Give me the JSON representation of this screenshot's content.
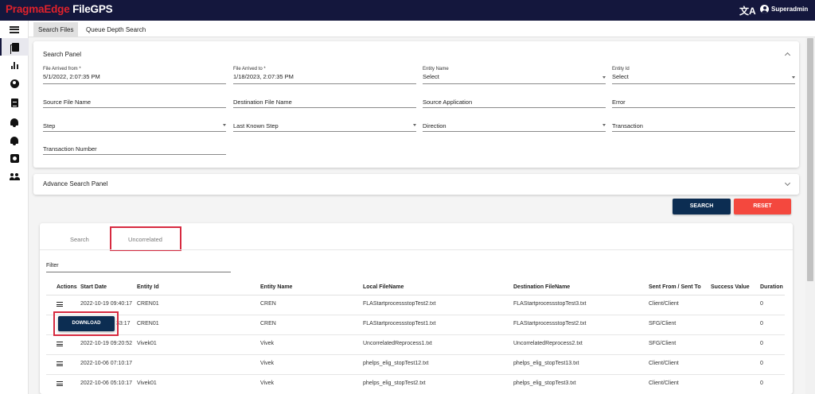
{
  "app": {
    "brand_red": "PragmaEdge",
    "brand_white": " FileGPS",
    "translate_icon": "translate-icon",
    "username": "Superadmin"
  },
  "colors": {
    "topbar": "#14173d",
    "brand_red": "#e0212b",
    "primary_button": "#0c2d52",
    "reset_button": "#f4483e",
    "highlight_border": "#d72a40"
  },
  "sidebar": {
    "items": [
      {
        "name": "menu-icon"
      },
      {
        "name": "search-files-icon"
      },
      {
        "name": "bar-chart-icon"
      },
      {
        "name": "account-icon"
      },
      {
        "name": "document-icon"
      },
      {
        "name": "alert-bell-icon"
      },
      {
        "name": "notification-bell-icon"
      },
      {
        "name": "settings-box-icon"
      },
      {
        "name": "users-group-icon"
      }
    ]
  },
  "tabs": [
    "Search Files",
    "Queue Depth Search"
  ],
  "search_panel": {
    "title": "Search Panel",
    "fields": {
      "arrived_from": {
        "label": "File Arrived from *",
        "value": "5/1/2022, 2:07:35 PM"
      },
      "arrived_to": {
        "label": "File Arrived to *",
        "value": "1/18/2023, 2:07:35 PM"
      },
      "entity_name": {
        "label": "Entity Name",
        "value": "Select"
      },
      "entity_id": {
        "label": "Entity Id",
        "value": "Select"
      },
      "source_file": "Source File Name",
      "destination_file": "Destination File Name",
      "source_app": "Source Application",
      "error": "Error",
      "step": "Step",
      "last_step": "Last Known Step",
      "direction": "Direction",
      "transaction": "Transaction",
      "transaction_number": "Transaction Number"
    }
  },
  "advance_panel": {
    "title": "Advance Search Panel"
  },
  "buttons": {
    "search": "SEARCH",
    "reset": "RESET"
  },
  "results": {
    "tabs": [
      "Search",
      "Uncorrelated"
    ],
    "filter_label": "Filter",
    "columns": [
      "Actions",
      "Start Date",
      "Entity Id",
      "Entity Name",
      "Local FileName",
      "Destination FileName",
      "Sent From / Sent To",
      "Success Value",
      "Duration"
    ],
    "rows": [
      {
        "start": "2022-10-19 09:40:17",
        "entity_id": "CREN01",
        "entity_name": "CREN",
        "local": "FLAStartprocessstopTest2.txt",
        "dest": "FLAStartprocessstopTest3.txt",
        "sent": "Client/Client",
        "success": "",
        "duration": "0"
      },
      {
        "start": "33:17",
        "entity_id": "CREN01",
        "entity_name": "CREN",
        "local": "FLAStartprocessstopTest1.txt",
        "dest": "FLAStartprocessstopTest2.txt",
        "sent": "SFG/Client",
        "success": "",
        "duration": "0"
      },
      {
        "start": "2022-10-19 09:20:52",
        "entity_id": "Vivek01",
        "entity_name": "Vivek",
        "local": "UncorrelatedReprocess1.txt",
        "dest": "UncorrelatedReprocess2.txt",
        "sent": "SFG/Client",
        "success": "",
        "duration": "0"
      },
      {
        "start": "2022-10-06 07:10:17",
        "entity_id": "",
        "entity_name": "Vivek",
        "local": "phelps_elig_stopTest12.txt",
        "dest": "phelps_elig_stopTest13.txt",
        "sent": "Client/Client",
        "success": "",
        "duration": "0"
      },
      {
        "start": "2022-10-06 05:10:17",
        "entity_id": "Vivek01",
        "entity_name": "Vivek",
        "local": "phelps_elig_stopTest2.txt",
        "dest": "phelps_elig_stopTest3.txt",
        "sent": "Client/Client",
        "success": "",
        "duration": "0"
      }
    ],
    "download_label": "DOWNLOAD"
  }
}
